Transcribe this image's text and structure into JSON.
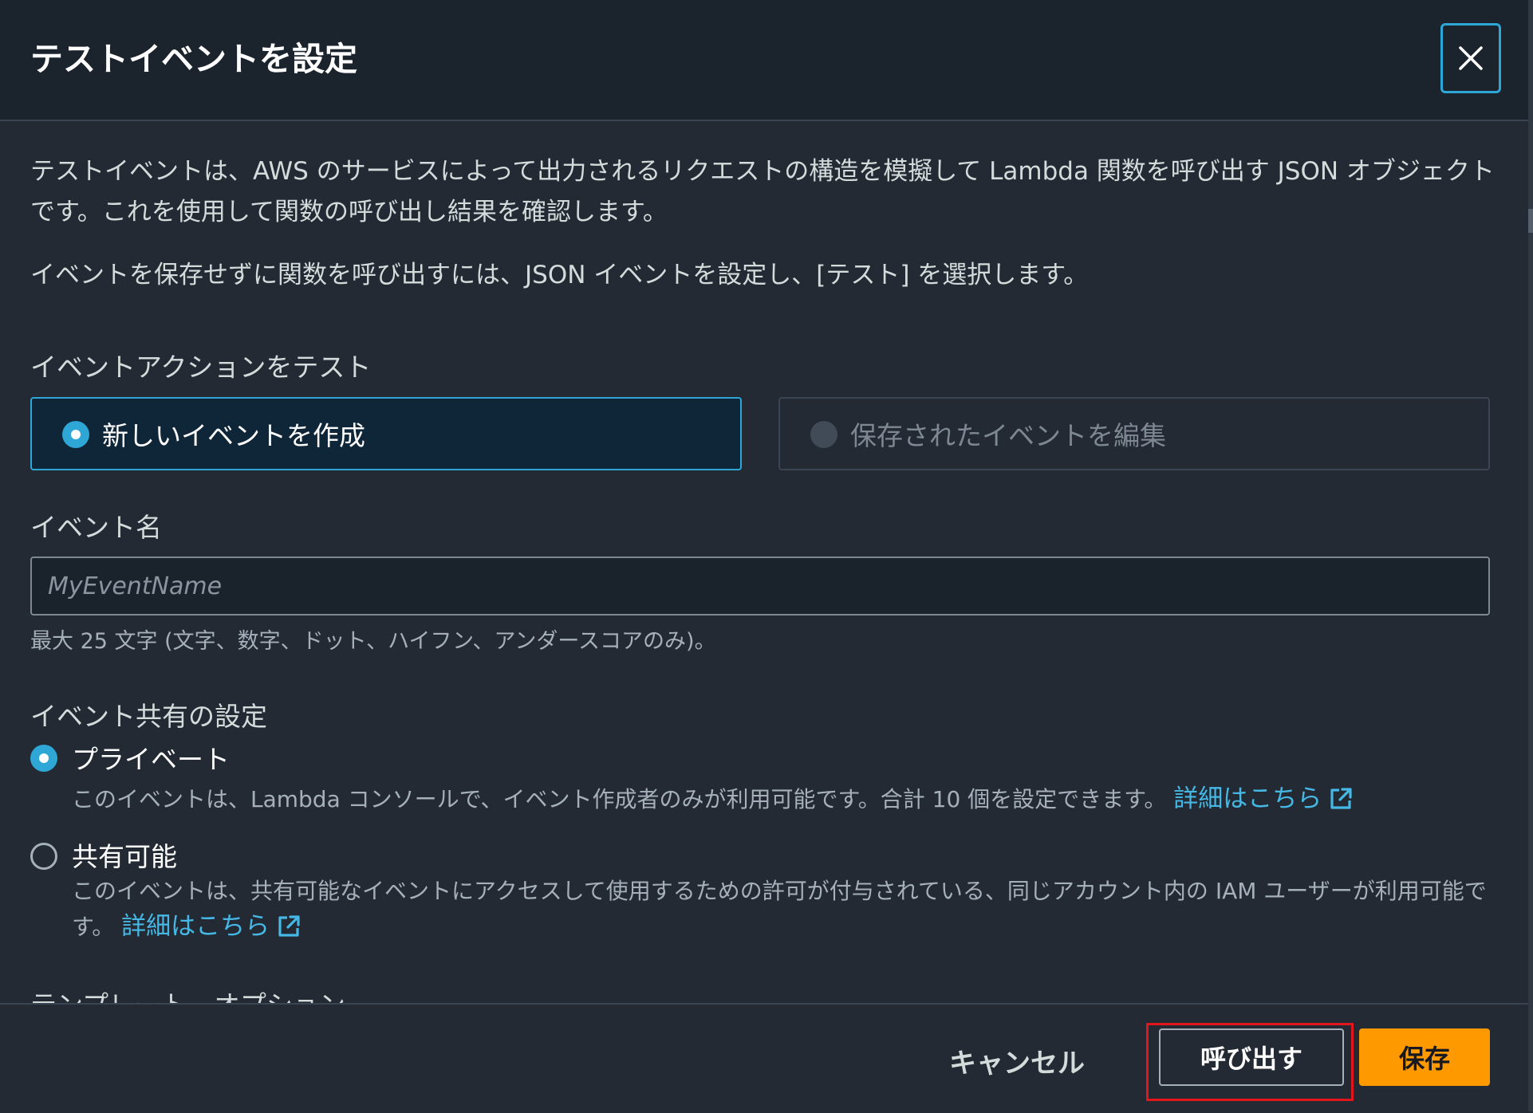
{
  "dialog": {
    "title": "テストイベントを設定",
    "close_label": "close"
  },
  "intro": {
    "paragraph1": "テストイベントは、AWS のサービスによって出力されるリクエストの構造を模擬して Lambda 関数を呼び出す JSON オブジェクトです。これを使用して関数の呼び出し結果を確認します。",
    "paragraph2": "イベントを保存せずに関数を呼び出すには、JSON イベントを設定し、[テスト] を選択します。"
  },
  "event_action": {
    "label": "イベントアクションをテスト",
    "options": [
      {
        "label": "新しいイベントを作成",
        "selected": true,
        "disabled": false
      },
      {
        "label": "保存されたイベントを編集",
        "selected": false,
        "disabled": true
      }
    ]
  },
  "event_name": {
    "label": "イベント名",
    "value": "",
    "placeholder": "MyEventName",
    "hint": "最大 25 文字 (文字、数字、ドット、ハイフン、アンダースコアのみ)。"
  },
  "sharing": {
    "label": "イベント共有の設定",
    "options": [
      {
        "label": "プライベート",
        "selected": true,
        "description": "このイベントは、Lambda コンソールで、イベント作成者のみが利用可能です。合計 10 個を設定できます。",
        "link": "詳細はこちら"
      },
      {
        "label": "共有可能",
        "selected": false,
        "description": "このイベントは、共有可能なイベントにアクセスして使用するための許可が付与されている、同じアカウント内の IAM ユーザーが利用可能です。",
        "link": "詳細はこちら"
      }
    ]
  },
  "templates": {
    "label": "テンプレート - オプション"
  },
  "footer": {
    "cancel_label": "キャンセル",
    "invoke_label": "呼び出す",
    "save_label": "保存"
  },
  "colors": {
    "accent": "#2ea6d6",
    "link": "#45b8e6",
    "primary_button": "#ff9900",
    "highlight": "#e4161d",
    "background": "#232a33",
    "header_background": "#1b232d"
  },
  "icons": {
    "close": "close-icon",
    "external_link": "external-link-icon"
  }
}
